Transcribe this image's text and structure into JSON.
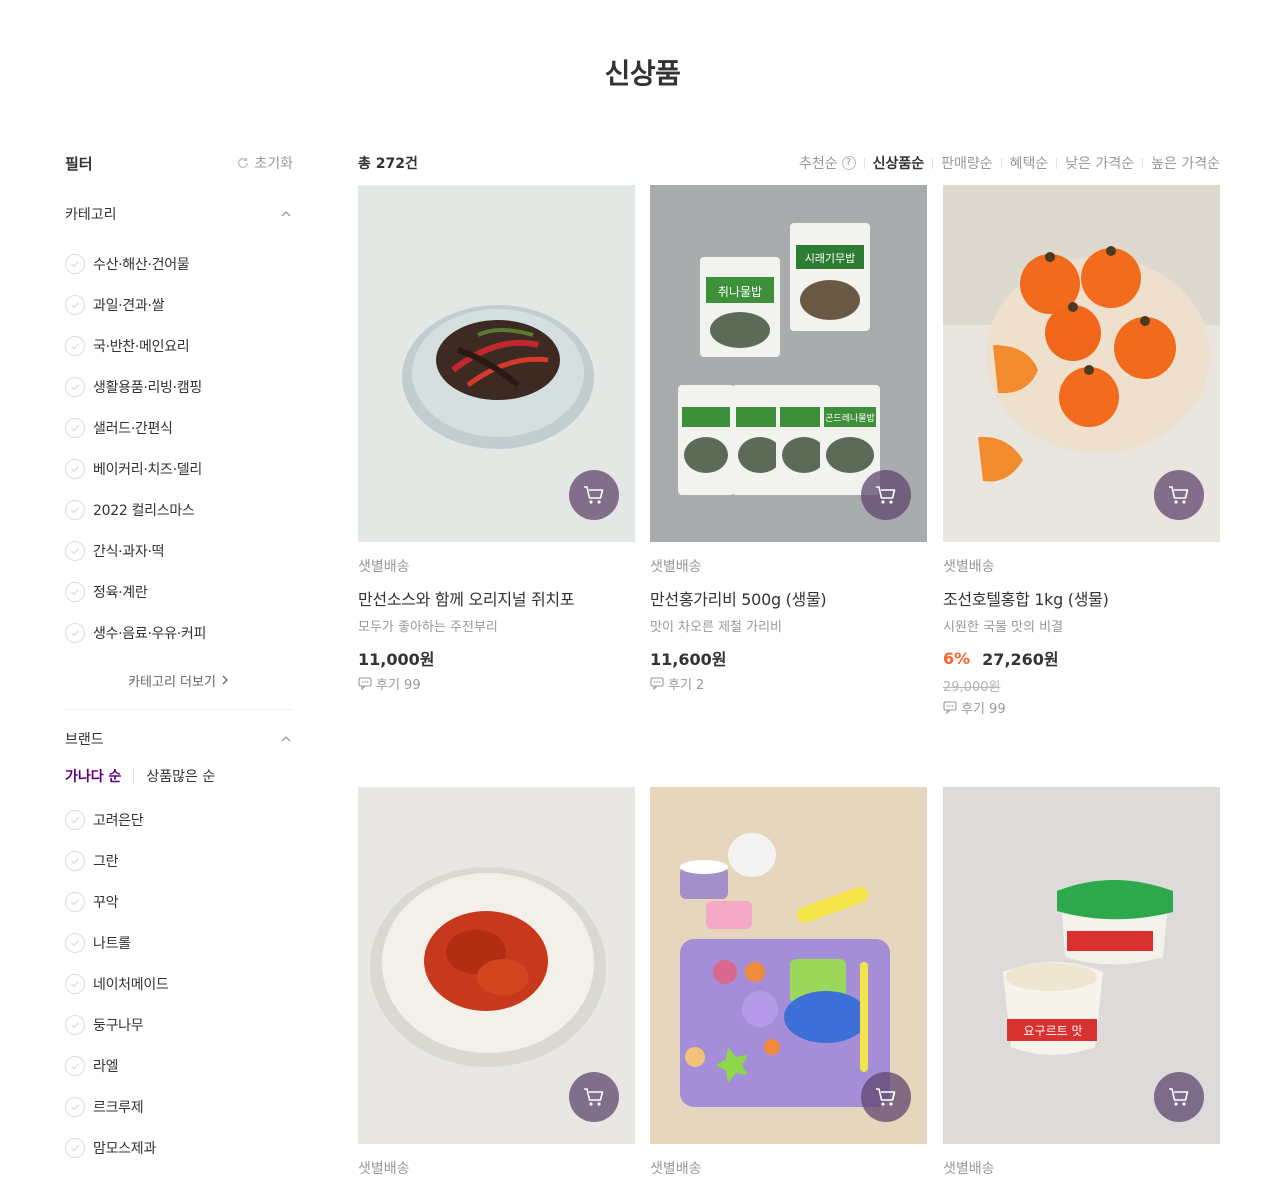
{
  "page": {
    "title": "신상품"
  },
  "filter": {
    "title": "필터",
    "reset_label": "초기화",
    "category": {
      "title": "카테고리",
      "items": [
        "수산·해산·건어물",
        "과일·견과·쌀",
        "국·반찬·메인요리",
        "생활용품·리빙·캠핑",
        "샐러드·간편식",
        "베이커리·치즈·델리",
        "2022 컬리스마스",
        "간식·과자·떡",
        "정육·계란",
        "생수·음료·우유·커피"
      ],
      "more_label": "카테고리 더보기"
    },
    "brand": {
      "title": "브랜드",
      "sort_active": "가나다 순",
      "sort_other": "상품많은 순",
      "items": [
        "고려은단",
        "그란",
        "꾸악",
        "나트롤",
        "네이처메이드",
        "둥구나무",
        "라엘",
        "르크루제",
        "맘모스제과"
      ]
    }
  },
  "toolbar": {
    "total": "총 272건",
    "sorts": [
      "추천순",
      "신상품순",
      "판매량순",
      "혜택순",
      "낮은 가격순",
      "높은 가격순"
    ],
    "active_sort": "신상품순"
  },
  "products": [
    {
      "delivery": "샛별배송",
      "name": "만선소스와 함께 오리지널 쥐치포",
      "desc": "모두가 좋아하는 주전부리",
      "price": "11,000원",
      "review": "후기 99"
    },
    {
      "delivery": "샛별배송",
      "name": "만선홍가리비 500g (생물)",
      "desc": "맛이 차오른 제철 가리비",
      "price": "11,600원",
      "review": "후기 2",
      "package_labels": [
        "시래기무밥",
        "취나물밥",
        "곤드레나물밥"
      ]
    },
    {
      "delivery": "샛별배송",
      "name": "조선호텔홍합 1kg (생물)",
      "desc": "시원한 국물 맛의 비결",
      "discount": "6%",
      "price": "27,260원",
      "original_price": "29,000원",
      "review": "후기 99"
    },
    {
      "delivery": "샛별배송"
    },
    {
      "delivery": "샛별배송"
    },
    {
      "delivery": "샛별배송",
      "package_label": "요구르트 맛"
    }
  ],
  "colors": {
    "accent": "#5f0080",
    "discount": "#fa622f",
    "cart_button": "#6b4f7a"
  },
  "icons": {
    "reset": "refresh-icon",
    "check": "check-icon",
    "cart": "cart-icon",
    "review": "speech-bubble-icon",
    "help": "question-icon"
  }
}
